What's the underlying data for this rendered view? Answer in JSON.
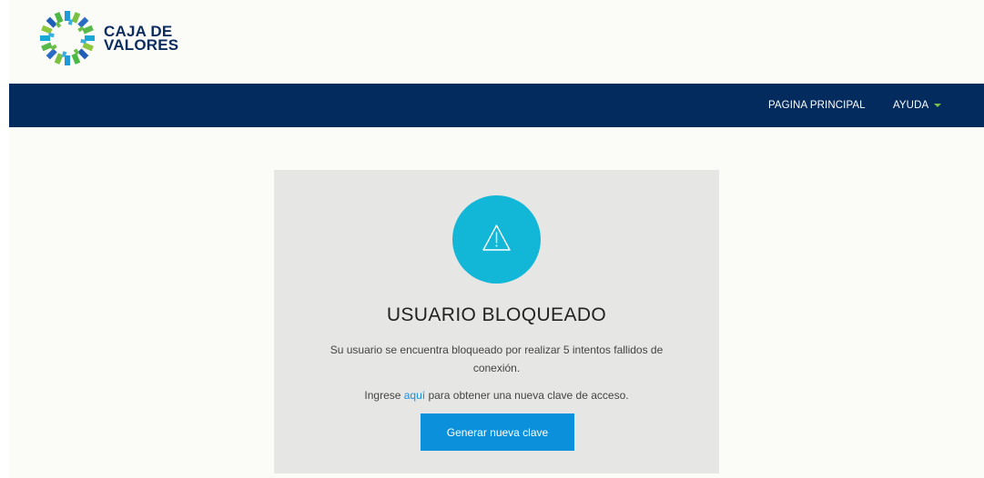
{
  "header": {
    "logo_line1": "CAJA DE",
    "logo_line2": "VALORES"
  },
  "nav": {
    "home": "PAGINA PRINCIPAL",
    "help": "AYUDA"
  },
  "card": {
    "icon": "warning-icon",
    "title": "USUARIO BLOQUEADO",
    "message": "Su usuario se encuentra bloqueado por realizar 5 intentos fallidos de conexión.",
    "hint_before": "Ingrese ",
    "hint_link": "aquí",
    "hint_after": " para obtener una nueva clave de acceso.",
    "button": "Generar nueva clave"
  },
  "colors": {
    "navbar": "#042b5e",
    "accent": "#12b7d8",
    "button": "#0b91dc",
    "link": "#1a8fd8",
    "caret": "#79c14a"
  }
}
